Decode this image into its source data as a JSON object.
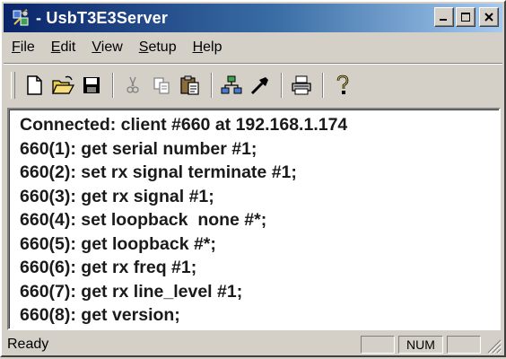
{
  "window": {
    "title": "- UsbT3E3Server"
  },
  "menu": [
    {
      "pre": "",
      "acc": "F",
      "post": "ile"
    },
    {
      "pre": "",
      "acc": "E",
      "post": "dit"
    },
    {
      "pre": "",
      "acc": "V",
      "post": "iew"
    },
    {
      "pre": "",
      "acc": "S",
      "post": "etup"
    },
    {
      "pre": "",
      "acc": "H",
      "post": "elp"
    }
  ],
  "toolbar": {
    "icons": [
      "new-document-icon",
      "open-folder-icon",
      "save-disk-icon",
      "cut-scissors-icon",
      "copy-icon",
      "paste-clipboard-icon",
      "network-icon",
      "tools-icon",
      "print-icon",
      "help-question-icon"
    ]
  },
  "output": {
    "lines": [
      "Connected: client #660 at 192.168.1.174",
      "660(1): get serial number #1;",
      "660(2): set rx signal terminate #1;",
      "660(3): get rx signal #1;",
      "660(4): set loopback  none #*;",
      "660(5): get loopback #*;",
      "660(6): get rx freq #1;",
      "660(7): get rx line_level #1;",
      "660(8): get version;"
    ]
  },
  "status": {
    "text": "Ready",
    "panel_num": "NUM"
  }
}
